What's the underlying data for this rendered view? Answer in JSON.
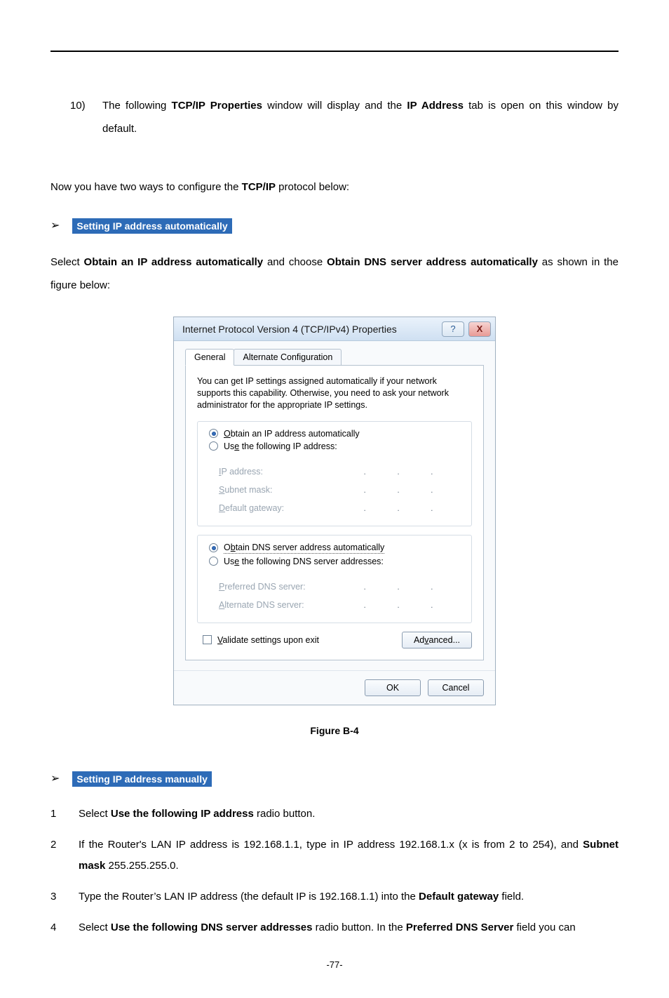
{
  "step10": {
    "number": "10)",
    "text_pre": "The following",
    "b1": "TCP/IP Properties",
    "text_mid": "window will display and the",
    "b2": "IP Address",
    "text_post": "tab is open on this window by default."
  },
  "para_two_ways_pre": "Now you have two ways to configure the",
  "para_two_ways_b": "TCP/IP",
  "para_two_ways_post": "protocol below:",
  "hl_auto": "Setting IP address automatically",
  "select_para_pre": "Select",
  "select_para_b1": "Obtain an IP address automatically",
  "select_para_mid": "and choose",
  "select_para_b2": "Obtain DNS server address automatically",
  "select_para_post": "as shown in the figure below:",
  "dialog": {
    "title": "Internet Protocol Version 4 (TCP/IPv4) Properties",
    "help_glyph": "?",
    "close_glyph": "X",
    "tabs": {
      "general": "General",
      "alt": "Alternate Configuration"
    },
    "desc": "You can get IP settings assigned automatically if your network supports this capability. Otherwise, you need to ask your network administrator for the appropriate IP settings.",
    "r_obtain_ip_pre": "O",
    "r_obtain_ip": "btain an IP address automatically",
    "r_use_ip_pre": "Us",
    "r_use_ip_u": "e",
    "r_use_ip_post": " the following IP address:",
    "lbl_ip_pre": "I",
    "lbl_ip": "P address:",
    "lbl_sub_pre": "S",
    "lbl_sub": "ubnet mask:",
    "lbl_gw_pre": "D",
    "lbl_gw": "efault gateway:",
    "r_obtain_dns_pre": "O",
    "r_obtain_dns_u": "b",
    "r_obtain_dns_post": "tain DNS server address automatically",
    "r_use_dns_pre": "Us",
    "r_use_dns_u": "e",
    "r_use_dns_post": " the following DNS server addresses:",
    "lbl_pdns_pre": "P",
    "lbl_pdns": "referred DNS server:",
    "lbl_adns_pre": "A",
    "lbl_adns": "lternate DNS server:",
    "chk_validate_pre": "V",
    "chk_validate": "alidate settings upon exit",
    "btn_adv_pre": "Ad",
    "btn_adv_u": "v",
    "btn_adv_post": "anced...",
    "btn_ok": "OK",
    "btn_cancel": "Cancel"
  },
  "fig_caption": "Figure B-4",
  "hl_manual": "Setting IP address manually",
  "manual": {
    "i1_n": "1",
    "i1_pre": "Select",
    "i1_b": "Use the following IP address",
    "i1_post": "radio button.",
    "i2_n": "2",
    "i2_pre": "If the Router's LAN IP address is 192.168.1.1, type in IP address 192.168.1.x (x is from 2 to 254), and",
    "i2_b": "Subnet mask",
    "i2_post": "255.255.255.0.",
    "i3_n": "3",
    "i3_pre": "Type the Router’s LAN IP address (the default IP is 192.168.1.1) into the",
    "i3_b": "Default gateway",
    "i3_post": "field.",
    "i4_n": "4",
    "i4_pre": "Select",
    "i4_b1": "Use the following DNS server addresses",
    "i4_mid": "radio button. In the",
    "i4_b2": "Preferred DNS Server",
    "i4_post": "field you can"
  },
  "page_number": "-77-",
  "arrow": "➢"
}
